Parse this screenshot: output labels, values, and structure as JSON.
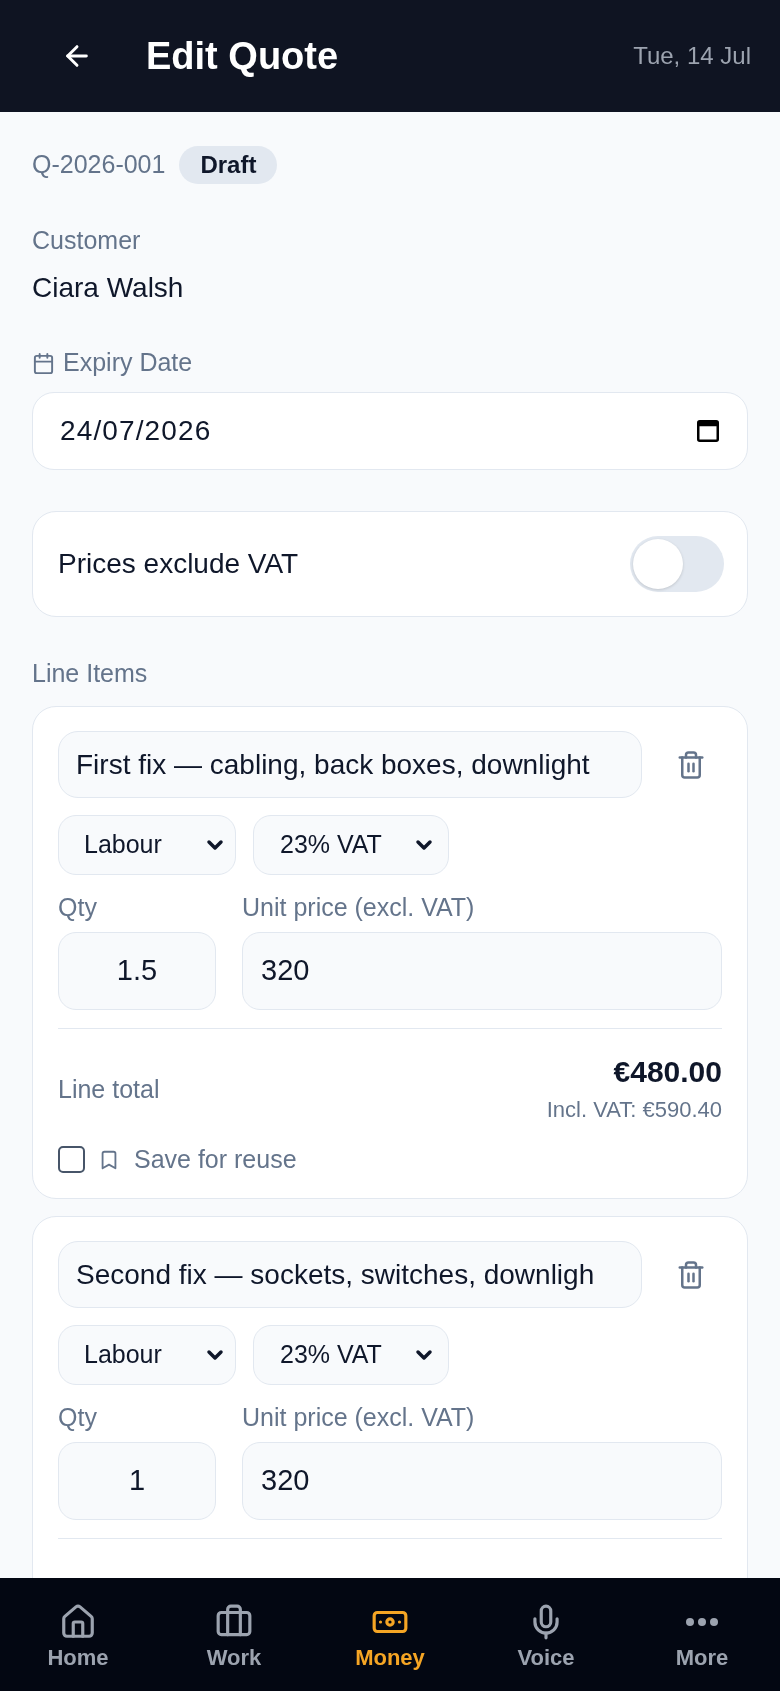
{
  "header": {
    "title": "Edit Quote",
    "date": "Tue, 14 Jul"
  },
  "quote": {
    "number": "Q-2026-001",
    "status": "Draft"
  },
  "customer": {
    "label": "Customer",
    "name": "Ciara Walsh"
  },
  "expiry": {
    "label": "Expiry Date",
    "value": "24/07/2026"
  },
  "vat_toggle": {
    "label": "Prices exclude VAT",
    "on": false
  },
  "line_items": {
    "label": "Line Items",
    "items": [
      {
        "description": "First fix — cabling, back boxes, downlight",
        "category": "Labour",
        "vat_rate": "23% VAT",
        "qty_label": "Qty",
        "qty": "1.5",
        "price_label": "Unit price (excl. VAT)",
        "price": "320",
        "total_label": "Line total",
        "total": "€480.00",
        "incl_vat": "Incl. VAT: €590.40",
        "save_label": "Save for reuse",
        "save_checked": false
      },
      {
        "description": "Second fix — sockets, switches, downligh",
        "category": "Labour",
        "vat_rate": "23% VAT",
        "qty_label": "Qty",
        "qty": "1",
        "price_label": "Unit price (excl. VAT)",
        "price": "320"
      }
    ]
  },
  "nav": [
    {
      "label": "Home",
      "selected": false
    },
    {
      "label": "Work",
      "selected": false
    },
    {
      "label": "Money",
      "selected": true
    },
    {
      "label": "Voice",
      "selected": false
    },
    {
      "label": "More",
      "selected": false
    }
  ]
}
